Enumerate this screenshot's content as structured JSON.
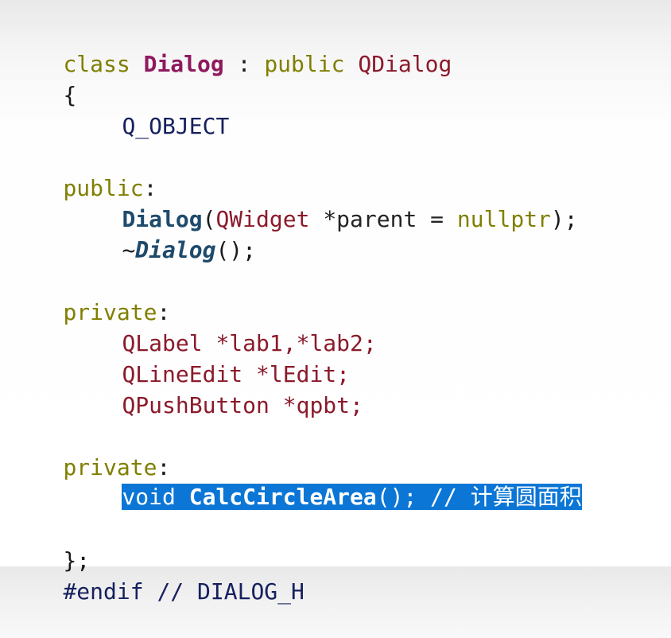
{
  "code": {
    "l1": {
      "kw_class": "class",
      "class_name": "Dialog",
      "colon": " : ",
      "kw_public": "public",
      "base": "QDialog"
    },
    "l2": {
      "brace": "{"
    },
    "l3": {
      "macro": "Q_OBJECT"
    },
    "l5": {
      "access": "public",
      "colon": ":"
    },
    "l6": {
      "ctor": "Dialog",
      "open": "(",
      "ptype": "QWidget",
      "rest": " *parent = ",
      "nullptr": "nullptr",
      "close": ");"
    },
    "l7": {
      "tilde": "~",
      "dtor": "Dialog",
      "rest": "();"
    },
    "l9": {
      "access": "private",
      "colon": ":"
    },
    "l10": {
      "type": "QLabel",
      "rest": " *lab1,*lab2;"
    },
    "l11": {
      "type": "QLineEdit",
      "rest": " *lEdit;"
    },
    "l12": {
      "type": "QPushButton",
      "rest": " *qpbt;"
    },
    "l14": {
      "access": "private",
      "colon": ":"
    },
    "l15": {
      "ret": "void",
      "fn": "CalcCircleArea",
      "rest": "(); // 计算圆面积"
    },
    "l17": {
      "text": "};"
    },
    "l18": {
      "text": "#endif // DIALOG_H"
    }
  }
}
